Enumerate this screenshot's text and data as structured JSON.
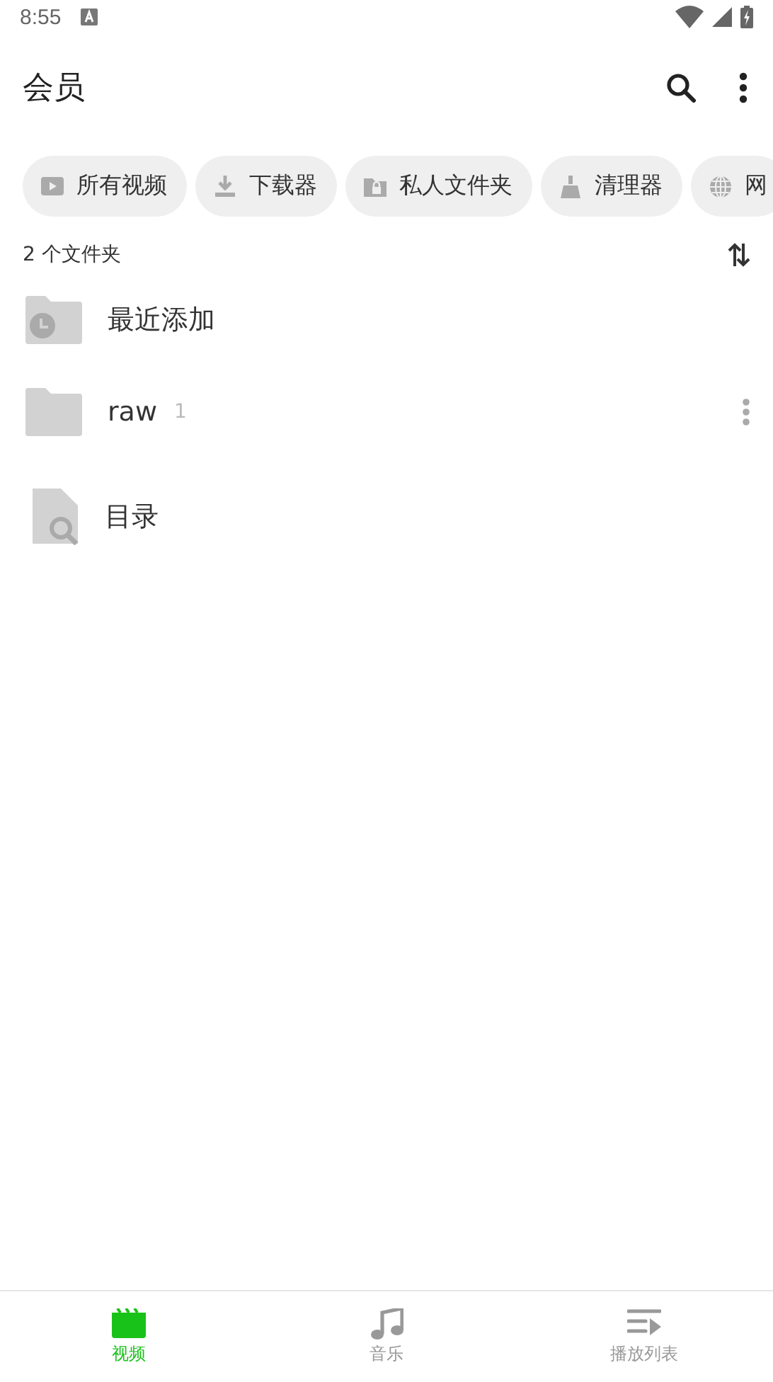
{
  "status_bar": {
    "time": "8:55"
  },
  "app_bar": {
    "title": "会员"
  },
  "chips": [
    {
      "kind": "video",
      "label": "所有视频"
    },
    {
      "kind": "download",
      "label": "下载器"
    },
    {
      "kind": "private",
      "label": "私人文件夹"
    },
    {
      "kind": "cleaner",
      "label": "清理器"
    },
    {
      "kind": "network",
      "label": "网"
    }
  ],
  "folder_count": "2 个文件夹",
  "items": [
    {
      "kind": "recent",
      "name": "最近添加"
    },
    {
      "kind": "folder",
      "name": "raw",
      "count": "1",
      "menu": true
    },
    {
      "kind": "catalog",
      "name": "目录"
    }
  ],
  "bottom_nav": [
    {
      "kind": "video",
      "label": "视频",
      "selected": true
    },
    {
      "kind": "music",
      "label": "音乐",
      "selected": false
    },
    {
      "kind": "playlist",
      "label": "播放列表",
      "selected": false
    }
  ]
}
